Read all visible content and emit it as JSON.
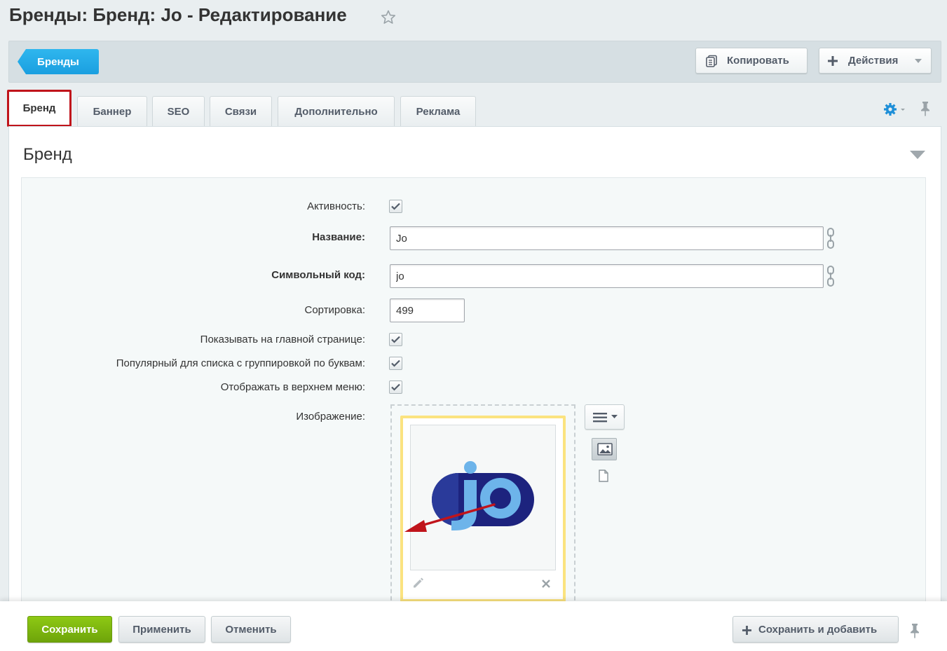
{
  "page": {
    "title": "Бренды: Бренд: Jo - Редактирование"
  },
  "toolbar": {
    "back_label": "Бренды",
    "copy_label": "Копировать",
    "actions_label": "Действия"
  },
  "tabs": [
    {
      "label": "Бренд",
      "active": true
    },
    {
      "label": "Баннер"
    },
    {
      "label": "SEO"
    },
    {
      "label": "Связи"
    },
    {
      "label": "Дополнительно"
    },
    {
      "label": "Реклама"
    }
  ],
  "section": {
    "title": "Бренд"
  },
  "form": {
    "active_label": "Активность:",
    "active_checked": true,
    "name_label": "Название:",
    "name_value": "Jo",
    "code_label": "Символьный код:",
    "code_value": "jo",
    "sort_label": "Сортировка:",
    "sort_value": "499",
    "show_main_label": "Показывать на главной странице:",
    "show_main_checked": true,
    "popular_label": "Популярный для списка с группировкой по буквам:",
    "popular_checked": true,
    "top_menu_label": "Отображать в верхнем меню:",
    "top_menu_checked": true,
    "image_label": "Изображение:"
  },
  "footer": {
    "save_label": "Сохранить",
    "apply_label": "Применить",
    "cancel_label": "Отменить",
    "save_add_label": "Сохранить и добавить"
  },
  "colors": {
    "accent_blue": "#1a9fe0",
    "save_green": "#7ab812",
    "active_tab_border": "#c0141b",
    "arrow_red": "#c0141b",
    "image_frame": "#fbe37f"
  },
  "icons": {
    "favorite": "star-icon",
    "settings": "gear-icon",
    "pin": "pin-icon",
    "copy": "copy-icon",
    "add": "plus-icon",
    "collapse": "triangle-down-icon",
    "translit": "link-chain-icon",
    "image_menu": "hamburger-icon",
    "image_type": "picture-icon",
    "file": "file-icon",
    "edit": "pencil-icon",
    "delete": "close-icon"
  }
}
